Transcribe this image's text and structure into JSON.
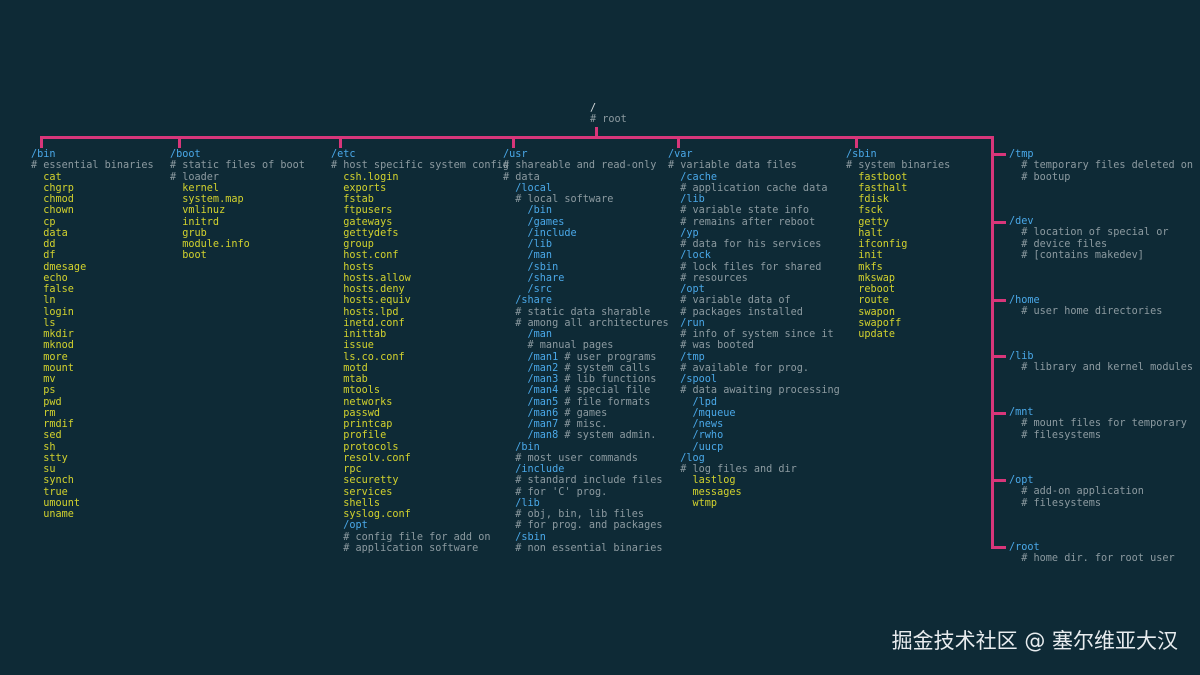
{
  "root": {
    "name": "/",
    "comment": "# root"
  },
  "watermark": "掘金技术社区 @ 塞尔维亚大汉",
  "colors": {
    "background": "#0e2a36",
    "connector": "#d8367a",
    "directory": "#4aa8e8",
    "comment": "#8c9aa0",
    "file": "#d2d22e"
  },
  "columns": {
    "bin": [
      [
        "dir",
        "/bin"
      ],
      [
        "cmt",
        "# essential binaries"
      ],
      [
        "file",
        "  cat"
      ],
      [
        "file",
        "  chgrp"
      ],
      [
        "file",
        "  chmod"
      ],
      [
        "file",
        "  chown"
      ],
      [
        "file",
        "  cp"
      ],
      [
        "file",
        "  data"
      ],
      [
        "file",
        "  dd"
      ],
      [
        "file",
        "  df"
      ],
      [
        "file",
        "  dmesage"
      ],
      [
        "file",
        "  echo"
      ],
      [
        "file",
        "  false"
      ],
      [
        "file",
        "  ln"
      ],
      [
        "file",
        "  login"
      ],
      [
        "file",
        "  ls"
      ],
      [
        "file",
        "  mkdir"
      ],
      [
        "file",
        "  mknod"
      ],
      [
        "file",
        "  more"
      ],
      [
        "file",
        "  mount"
      ],
      [
        "file",
        "  mv"
      ],
      [
        "file",
        "  ps"
      ],
      [
        "file",
        "  pwd"
      ],
      [
        "file",
        "  rm"
      ],
      [
        "file",
        "  rmdif"
      ],
      [
        "file",
        "  sed"
      ],
      [
        "file",
        "  sh"
      ],
      [
        "file",
        "  stty"
      ],
      [
        "file",
        "  su"
      ],
      [
        "file",
        "  synch"
      ],
      [
        "file",
        "  true"
      ],
      [
        "file",
        "  umount"
      ],
      [
        "file",
        "  uname"
      ]
    ],
    "boot": [
      [
        "dir",
        "/boot"
      ],
      [
        "cmt",
        "# static files of boot"
      ],
      [
        "cmt",
        "# loader"
      ],
      [
        "file",
        "  kernel"
      ],
      [
        "file",
        "  system.map"
      ],
      [
        "file",
        "  vmlinuz"
      ],
      [
        "file",
        "  initrd"
      ],
      [
        "file",
        "  grub"
      ],
      [
        "file",
        "  module.info"
      ],
      [
        "file",
        "  boot"
      ]
    ],
    "etc": [
      [
        "dir",
        "/etc"
      ],
      [
        "cmt",
        "# host specific system config"
      ],
      [
        "file",
        "  csh.login"
      ],
      [
        "file",
        "  exports"
      ],
      [
        "file",
        "  fstab"
      ],
      [
        "file",
        "  ftpusers"
      ],
      [
        "file",
        "  gateways"
      ],
      [
        "file",
        "  gettydefs"
      ],
      [
        "file",
        "  group"
      ],
      [
        "file",
        "  host.conf"
      ],
      [
        "file",
        "  hosts"
      ],
      [
        "file",
        "  hosts.allow"
      ],
      [
        "file",
        "  hosts.deny"
      ],
      [
        "file",
        "  hosts.equiv"
      ],
      [
        "file",
        "  hosts.lpd"
      ],
      [
        "file",
        "  inetd.conf"
      ],
      [
        "file",
        "  inittab"
      ],
      [
        "file",
        "  issue"
      ],
      [
        "file",
        "  ls.co.conf"
      ],
      [
        "file",
        "  motd"
      ],
      [
        "file",
        "  mtab"
      ],
      [
        "file",
        "  mtools"
      ],
      [
        "file",
        "  networks"
      ],
      [
        "file",
        "  passwd"
      ],
      [
        "file",
        "  printcap"
      ],
      [
        "file",
        "  profile"
      ],
      [
        "file",
        "  protocols"
      ],
      [
        "file",
        "  resolv.conf"
      ],
      [
        "file",
        "  rpc"
      ],
      [
        "file",
        "  securetty"
      ],
      [
        "file",
        "  services"
      ],
      [
        "file",
        "  shells"
      ],
      [
        "file",
        "  syslog.conf"
      ],
      [
        "dir",
        "  /opt"
      ],
      [
        "cmt",
        "  # config file for add on"
      ],
      [
        "cmt",
        "  # application software"
      ]
    ],
    "usr": [
      [
        "dir",
        "/usr"
      ],
      [
        "cmt",
        "# shareable and read-only"
      ],
      [
        "cmt",
        "# data"
      ],
      [
        "dir",
        "  /local"
      ],
      [
        "cmt",
        "  # local software"
      ],
      [
        "dir",
        "    /bin"
      ],
      [
        "dir",
        "    /games"
      ],
      [
        "dir",
        "    /include"
      ],
      [
        "dir",
        "    /lib"
      ],
      [
        "dir",
        "    /man"
      ],
      [
        "dir",
        "    /sbin"
      ],
      [
        "dir",
        "    /share"
      ],
      [
        "dir",
        "    /src"
      ],
      [
        "dir",
        "  /share"
      ],
      [
        "cmt",
        "  # static data sharable"
      ],
      [
        "cmt",
        "  # among all architectures"
      ],
      [
        "dir",
        "    /man"
      ],
      [
        "cmt",
        "    # manual pages"
      ],
      [
        "mix",
        "    /man1",
        " # user programs"
      ],
      [
        "mix",
        "    /man2",
        " # system calls"
      ],
      [
        "mix",
        "    /man3",
        " # lib functions"
      ],
      [
        "mix",
        "    /man4",
        " # special file"
      ],
      [
        "mix",
        "    /man5",
        " # file formats"
      ],
      [
        "mix",
        "    /man6",
        " # games"
      ],
      [
        "mix",
        "    /man7",
        " # misc."
      ],
      [
        "mix",
        "    /man8",
        " # system admin."
      ],
      [
        "dir",
        "  /bin"
      ],
      [
        "cmt",
        "  # most user commands"
      ],
      [
        "dir",
        "  /include"
      ],
      [
        "cmt",
        "  # standard include files"
      ],
      [
        "cmt",
        "  # for 'C' prog."
      ],
      [
        "dir",
        "  /lib"
      ],
      [
        "cmt",
        "  # obj, bin, lib files"
      ],
      [
        "cmt",
        "  # for prog. and packages"
      ],
      [
        "dir",
        "  /sbin"
      ],
      [
        "cmt",
        "  # non essential binaries"
      ]
    ],
    "var": [
      [
        "dir",
        "/var"
      ],
      [
        "cmt",
        "# variable data files"
      ],
      [
        "dir",
        "  /cache"
      ],
      [
        "cmt",
        "  # application cache data"
      ],
      [
        "dir",
        "  /lib"
      ],
      [
        "cmt",
        "  # variable state info"
      ],
      [
        "cmt",
        "  # remains after reboot"
      ],
      [
        "dir",
        "  /yp"
      ],
      [
        "cmt",
        "  # data for his services"
      ],
      [
        "dir",
        "  /lock"
      ],
      [
        "cmt",
        "  # lock files for shared"
      ],
      [
        "cmt",
        "  # resources"
      ],
      [
        "dir",
        "  /opt"
      ],
      [
        "cmt",
        "  # variable data of"
      ],
      [
        "cmt",
        "  # packages installed"
      ],
      [
        "dir",
        "  /run"
      ],
      [
        "cmt",
        "  # info of system since it"
      ],
      [
        "cmt",
        "  # was booted"
      ],
      [
        "dir",
        "  /tmp"
      ],
      [
        "cmt",
        "  # available for prog."
      ],
      [
        "dir",
        "  /spool"
      ],
      [
        "cmt",
        "  # data awaiting processing"
      ],
      [
        "dir",
        "    /lpd"
      ],
      [
        "dir",
        "    /mqueue"
      ],
      [
        "dir",
        "    /news"
      ],
      [
        "dir",
        "    /rwho"
      ],
      [
        "dir",
        "    /uucp"
      ],
      [
        "dir",
        "  /log"
      ],
      [
        "cmt",
        "  # log files and dir"
      ],
      [
        "file",
        "    lastlog"
      ],
      [
        "file",
        "    messages"
      ],
      [
        "file",
        "    wtmp"
      ]
    ],
    "sbin": [
      [
        "dir",
        "/sbin"
      ],
      [
        "cmt",
        "# system binaries"
      ],
      [
        "file",
        "  fastboot"
      ],
      [
        "file",
        "  fasthalt"
      ],
      [
        "file",
        "  fdisk"
      ],
      [
        "file",
        "  fsck"
      ],
      [
        "file",
        "  getty"
      ],
      [
        "file",
        "  halt"
      ],
      [
        "file",
        "  ifconfig"
      ],
      [
        "file",
        "  init"
      ],
      [
        "file",
        "  mkfs"
      ],
      [
        "file",
        "  mkswap"
      ],
      [
        "file",
        "  reboot"
      ],
      [
        "file",
        "  route"
      ],
      [
        "file",
        "  swapon"
      ],
      [
        "file",
        "  swapoff"
      ],
      [
        "file",
        "  update"
      ]
    ]
  },
  "right_dirs": [
    {
      "name": "/tmp",
      "lines": [
        "# temporary files deleted on",
        "# bootup"
      ]
    },
    {
      "name": "/dev",
      "lines": [
        "# location of special or",
        "# device files",
        "# [contains makedev]"
      ]
    },
    {
      "name": "/home",
      "lines": [
        "# user home directories"
      ]
    },
    {
      "name": "/lib",
      "lines": [
        "# library and kernel modules"
      ]
    },
    {
      "name": "/mnt",
      "lines": [
        "# mount files for temporary",
        "# filesystems"
      ]
    },
    {
      "name": "/opt",
      "lines": [
        "# add-on application",
        "# filesystems"
      ]
    },
    {
      "name": "/root",
      "lines": [
        "# home dir. for root user"
      ]
    }
  ]
}
